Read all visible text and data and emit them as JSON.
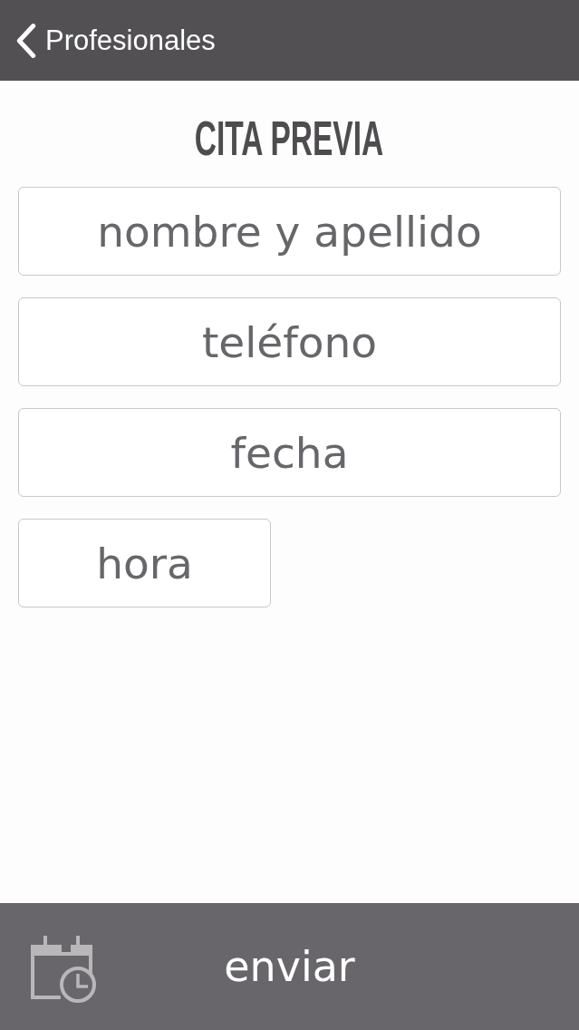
{
  "nav_bar": {
    "back_label": "Profesionales"
  },
  "title": "CITA PREVIA",
  "fields": [
    {
      "kind": "text",
      "placeholder": "nombre y apellido"
    },
    {
      "kind": "text",
      "placeholder": "teléfono"
    },
    {
      "kind": "text",
      "placeholder": "fecha"
    },
    {
      "kind": "time",
      "placeholder": "hora"
    }
  ],
  "submit": {
    "label": "enviar"
  }
}
